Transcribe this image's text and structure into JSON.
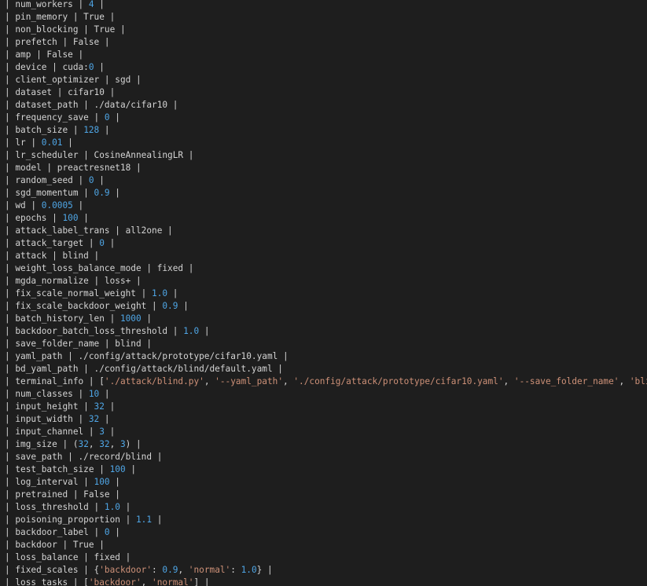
{
  "colors": {
    "background": "#1e1e1e",
    "text": "#d4d4d4",
    "number": "#4fa6e6",
    "string": "#ce9178"
  },
  "terminal": {
    "lines": [
      [
        {
          "t": "| num_workers | "
        },
        {
          "t": "4",
          "c": "num"
        },
        {
          "t": " |"
        }
      ],
      [
        {
          "t": "| pin_memory | True |"
        }
      ],
      [
        {
          "t": "| non_blocking | True |"
        }
      ],
      [
        {
          "t": "| prefetch | False |"
        }
      ],
      [
        {
          "t": "| amp | False |"
        }
      ],
      [
        {
          "t": "| device | cuda:"
        },
        {
          "t": "0",
          "c": "num"
        },
        {
          "t": " |"
        }
      ],
      [
        {
          "t": "| client_optimizer | sgd |"
        }
      ],
      [
        {
          "t": "| dataset | cifar10 |"
        }
      ],
      [
        {
          "t": "| dataset_path | ./data/cifar10 |"
        }
      ],
      [
        {
          "t": "| frequency_save | "
        },
        {
          "t": "0",
          "c": "num"
        },
        {
          "t": " |"
        }
      ],
      [
        {
          "t": "| batch_size | "
        },
        {
          "t": "128",
          "c": "num"
        },
        {
          "t": " |"
        }
      ],
      [
        {
          "t": "| lr | "
        },
        {
          "t": "0.01",
          "c": "num"
        },
        {
          "t": " |"
        }
      ],
      [
        {
          "t": "| lr_scheduler | CosineAnnealingLR |"
        }
      ],
      [
        {
          "t": "| model | preactresnet18 |"
        }
      ],
      [
        {
          "t": "| random_seed | "
        },
        {
          "t": "0",
          "c": "num"
        },
        {
          "t": " |"
        }
      ],
      [
        {
          "t": "| sgd_momentum | "
        },
        {
          "t": "0.9",
          "c": "num"
        },
        {
          "t": " |"
        }
      ],
      [
        {
          "t": "| wd | "
        },
        {
          "t": "0.0005",
          "c": "num"
        },
        {
          "t": " |"
        }
      ],
      [
        {
          "t": "| epochs | "
        },
        {
          "t": "100",
          "c": "num"
        },
        {
          "t": " |"
        }
      ],
      [
        {
          "t": "| attack_label_trans | all2one |"
        }
      ],
      [
        {
          "t": "| attack_target | "
        },
        {
          "t": "0",
          "c": "num"
        },
        {
          "t": " |"
        }
      ],
      [
        {
          "t": "| attack | blind |"
        }
      ],
      [
        {
          "t": "| weight_loss_balance_mode | fixed |"
        }
      ],
      [
        {
          "t": "| mgda_normalize | loss+ |"
        }
      ],
      [
        {
          "t": "| fix_scale_normal_weight | "
        },
        {
          "t": "1.0",
          "c": "num"
        },
        {
          "t": " |"
        }
      ],
      [
        {
          "t": "| fix_scale_backdoor_weight | "
        },
        {
          "t": "0.9",
          "c": "num"
        },
        {
          "t": " |"
        }
      ],
      [
        {
          "t": "| batch_history_len | "
        },
        {
          "t": "1000",
          "c": "num"
        },
        {
          "t": " |"
        }
      ],
      [
        {
          "t": "| backdoor_batch_loss_threshold | "
        },
        {
          "t": "1.0",
          "c": "num"
        },
        {
          "t": " |"
        }
      ],
      [
        {
          "t": "| save_folder_name | blind |"
        }
      ],
      [
        {
          "t": "| yaml_path | ./config/attack/prototype/cifar10.yaml |"
        }
      ],
      [
        {
          "t": "| bd_yaml_path | ./config/attack/blind/default.yaml |"
        }
      ],
      [
        {
          "t": "| terminal_info | ["
        },
        {
          "t": "'./attack/blind.py'",
          "c": "str"
        },
        {
          "t": ", "
        },
        {
          "t": "'--yaml_path'",
          "c": "str"
        },
        {
          "t": ", "
        },
        {
          "t": "'./config/attack/prototype/cifar10.yaml'",
          "c": "str"
        },
        {
          "t": ", "
        },
        {
          "t": "'--save_folder_name'",
          "c": "str"
        },
        {
          "t": ", "
        },
        {
          "t": "'blind'",
          "c": "str"
        },
        {
          "t": "] |"
        }
      ],
      [
        {
          "t": "| num_classes | "
        },
        {
          "t": "10",
          "c": "num"
        },
        {
          "t": " |"
        }
      ],
      [
        {
          "t": "| input_height | "
        },
        {
          "t": "32",
          "c": "num"
        },
        {
          "t": " |"
        }
      ],
      [
        {
          "t": "| input_width | "
        },
        {
          "t": "32",
          "c": "num"
        },
        {
          "t": " |"
        }
      ],
      [
        {
          "t": "| input_channel | "
        },
        {
          "t": "3",
          "c": "num"
        },
        {
          "t": " |"
        }
      ],
      [
        {
          "t": "| img_size | ("
        },
        {
          "t": "32",
          "c": "num"
        },
        {
          "t": ", "
        },
        {
          "t": "32",
          "c": "num"
        },
        {
          "t": ", "
        },
        {
          "t": "3",
          "c": "num"
        },
        {
          "t": ") |"
        }
      ],
      [
        {
          "t": "| save_path | ./record/blind |"
        }
      ],
      [
        {
          "t": "| test_batch_size | "
        },
        {
          "t": "100",
          "c": "num"
        },
        {
          "t": " |"
        }
      ],
      [
        {
          "t": "| log_interval | "
        },
        {
          "t": "100",
          "c": "num"
        },
        {
          "t": " |"
        }
      ],
      [
        {
          "t": "| pretrained | False |"
        }
      ],
      [
        {
          "t": "| loss_threshold | "
        },
        {
          "t": "1.0",
          "c": "num"
        },
        {
          "t": " |"
        }
      ],
      [
        {
          "t": "| poisoning_proportion | "
        },
        {
          "t": "1.1",
          "c": "num"
        },
        {
          "t": " |"
        }
      ],
      [
        {
          "t": "| backdoor_label | "
        },
        {
          "t": "0",
          "c": "num"
        },
        {
          "t": " |"
        }
      ],
      [
        {
          "t": "| backdoor | True |"
        }
      ],
      [
        {
          "t": "| loss_balance | fixed |"
        }
      ],
      [
        {
          "t": "| fixed_scales | {"
        },
        {
          "t": "'backdoor'",
          "c": "str"
        },
        {
          "t": ": "
        },
        {
          "t": "0.9",
          "c": "num"
        },
        {
          "t": ", "
        },
        {
          "t": "'normal'",
          "c": "str"
        },
        {
          "t": ": "
        },
        {
          "t": "1.0",
          "c": "num"
        },
        {
          "t": "} |"
        }
      ],
      [
        {
          "t": "| loss_tasks | ["
        },
        {
          "t": "'backdoor'",
          "c": "str"
        },
        {
          "t": ", "
        },
        {
          "t": "'normal'",
          "c": "str"
        },
        {
          "t": "] |"
        }
      ]
    ]
  }
}
